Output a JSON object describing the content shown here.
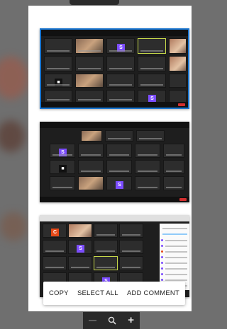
{
  "action_bar": {
    "copy_label": "COPY",
    "select_all_label": "SELECT ALL",
    "add_comment_label": "ADD COMMENT"
  },
  "zoom_controls": {
    "zoom_out_glyph": "—",
    "zoom_icon": "zoom-icon",
    "zoom_in_glyph": "+"
  },
  "pages": [
    {
      "selected": true
    },
    {
      "selected": false
    },
    {
      "selected": false
    }
  ],
  "colors": {
    "selection": "#1976d2",
    "avatar_purple": "#7c4dff",
    "avatar_orange": "#e64a19",
    "end_meeting_red": "#d32f2f"
  }
}
